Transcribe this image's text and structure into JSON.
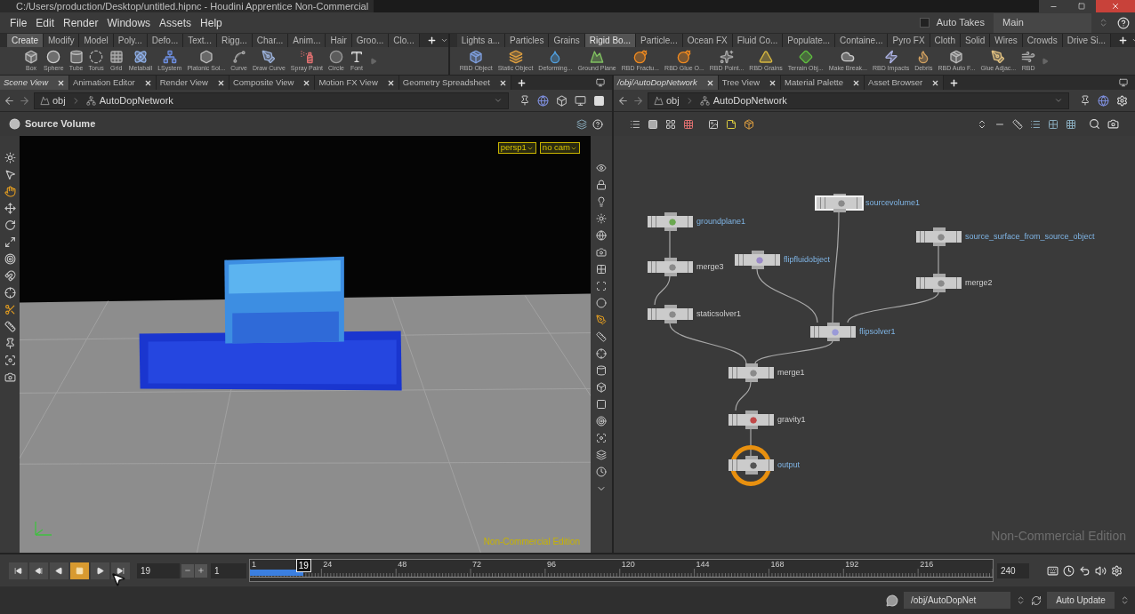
{
  "window": {
    "title": "C:/Users/production/Desktop/untitled.hipnc - Houdini Apprentice Non-Commercial"
  },
  "menu": [
    "File",
    "Edit",
    "Render",
    "Windows",
    "Assets",
    "Help"
  ],
  "auto_takes": {
    "label": "Auto Takes",
    "checked": false
  },
  "take": {
    "value": "Main"
  },
  "shelves": [
    {
      "tabs": [
        {
          "label": "Create",
          "selected": true
        },
        {
          "label": "Modify",
          "selected": false
        },
        {
          "label": "Model",
          "selected": false
        },
        {
          "label": "Poly...",
          "selected": false
        },
        {
          "label": "Defo...",
          "selected": false
        },
        {
          "label": "Text...",
          "selected": false
        },
        {
          "label": "Rigg...",
          "selected": false
        },
        {
          "label": "Char...",
          "selected": false
        },
        {
          "label": "Anim...",
          "selected": false
        },
        {
          "label": "Hair",
          "selected": false
        },
        {
          "label": "Groo...",
          "selected": false
        },
        {
          "label": "Clo...",
          "selected": false
        }
      ],
      "tools": [
        "Box",
        "Sphere",
        "Tube",
        "Torus",
        "Grid",
        "Metaball",
        "LSystem",
        "Platonic Sol...",
        "Curve",
        "Draw Curve",
        "Spray Paint",
        "Circle",
        "Font"
      ]
    },
    {
      "tabs": [
        {
          "label": "Lights a...",
          "selected": false
        },
        {
          "label": "Particles",
          "selected": false
        },
        {
          "label": "Grains",
          "selected": false
        },
        {
          "label": "Rigid Bo...",
          "selected": true
        },
        {
          "label": "Particle...",
          "selected": false
        },
        {
          "label": "Ocean FX",
          "selected": false
        },
        {
          "label": "Fluid Co...",
          "selected": false
        },
        {
          "label": "Populate...",
          "selected": false
        },
        {
          "label": "Containe...",
          "selected": false
        },
        {
          "label": "Pyro FX",
          "selected": false
        },
        {
          "label": "Cloth",
          "selected": false
        },
        {
          "label": "Solid",
          "selected": false
        },
        {
          "label": "Wires",
          "selected": false
        },
        {
          "label": "Crowds",
          "selected": false
        },
        {
          "label": "Drive Si...",
          "selected": false
        }
      ],
      "tools": [
        "RBD Object",
        "Static Object",
        "Deforming...",
        "Ground Plane",
        "RBD Fractu...",
        "RBD Glue O...",
        "RBD Point...",
        "RBD Grains",
        "Terrain Obj...",
        "Make Break...",
        "RBD Impacts",
        "Debris",
        "RBD Auto F...",
        "Glue Adjac...",
        "RBD"
      ]
    }
  ],
  "left_pane": {
    "tabs": [
      {
        "label": "Scene View",
        "selected": true
      },
      {
        "label": "Animation Editor",
        "selected": false
      },
      {
        "label": "Render View",
        "selected": false
      },
      {
        "label": "Composite View",
        "selected": false
      },
      {
        "label": "Motion FX View",
        "selected": false
      },
      {
        "label": "Geometry Spreadsheet",
        "selected": false
      }
    ],
    "path": [
      "obj",
      "AutoDopNetwork"
    ],
    "viewer": {
      "title": "Source Volume",
      "camera": "persp1",
      "view": "no cam",
      "edition": "Non-Commercial Edition"
    }
  },
  "right_pane": {
    "tabs": [
      {
        "label": "/obj/AutoDopNetwork",
        "selected": true
      },
      {
        "label": "Tree View",
        "selected": false
      },
      {
        "label": "Material Palette",
        "selected": false
      },
      {
        "label": "Asset Browser",
        "selected": false
      }
    ],
    "path": [
      "obj",
      "AutoDopNetwork"
    ],
    "network": {
      "edition": "Non-Commercial Edition",
      "nodes": [
        {
          "name": "groundplane1",
          "highlighted": true,
          "selected": false,
          "display": false
        },
        {
          "name": "merge3",
          "highlighted": false,
          "selected": false,
          "display": false
        },
        {
          "name": "staticsolver1",
          "highlighted": false,
          "selected": false,
          "display": false
        },
        {
          "name": "flipfluidobject",
          "highlighted": true,
          "selected": false,
          "display": false
        },
        {
          "name": "sourcevolume1",
          "highlighted": true,
          "selected": true,
          "display": false
        },
        {
          "name": "source_surface_from_source_object",
          "highlighted": true,
          "selected": false,
          "display": false
        },
        {
          "name": "merge2",
          "highlighted": false,
          "selected": false,
          "display": false
        },
        {
          "name": "flipsolver1",
          "highlighted": true,
          "selected": false,
          "display": false
        },
        {
          "name": "merge1",
          "highlighted": false,
          "selected": false,
          "display": false
        },
        {
          "name": "gravity1",
          "highlighted": false,
          "selected": false,
          "display": false
        },
        {
          "name": "output",
          "highlighted": true,
          "selected": false,
          "display": true
        }
      ]
    }
  },
  "timeline": {
    "transport": [
      {
        "kind": "first",
        "selected": false
      },
      {
        "kind": "prev-key",
        "selected": false
      },
      {
        "kind": "reverse",
        "selected": false
      },
      {
        "kind": "stop",
        "selected": true
      },
      {
        "kind": "play",
        "selected": false
      },
      {
        "kind": "last",
        "selected": false
      }
    ],
    "frame": "19",
    "start": "1",
    "end": "240",
    "ticks": [
      "1",
      "24",
      "48",
      "72",
      "96",
      "120",
      "144",
      "168",
      "192",
      "216"
    ],
    "cache": {
      "level": 0.072
    },
    "playhead": {
      "label": "19",
      "level": 0.075
    }
  },
  "status_bar": {
    "path": "/obj/AutoDopNet",
    "button": "Auto Update"
  }
}
